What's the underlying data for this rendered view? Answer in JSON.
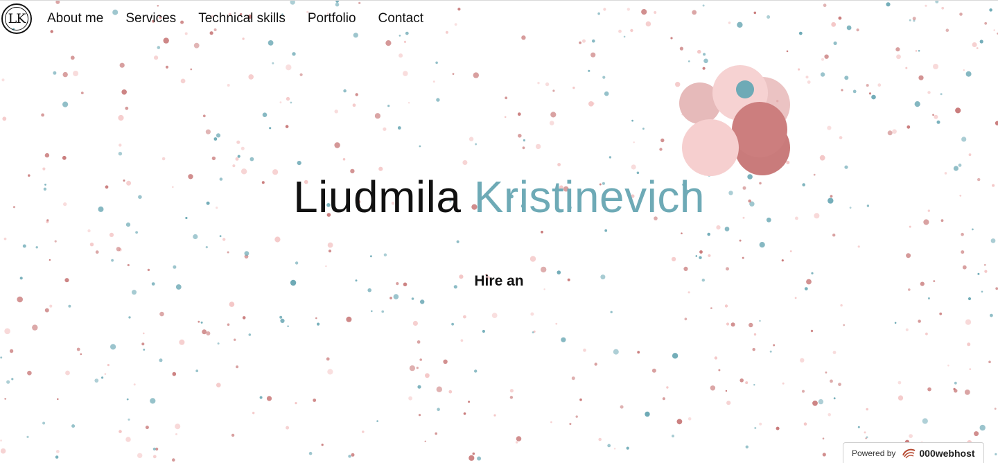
{
  "nav": {
    "logo_text": "LK",
    "links": [
      {
        "label": "About me"
      },
      {
        "label": "Services"
      },
      {
        "label": "Technical skills"
      },
      {
        "label": "Portfolio"
      },
      {
        "label": "Contact"
      }
    ]
  },
  "hero": {
    "first_name": "Liudmila",
    "last_name": "Kristinevich",
    "subtitle": "Hire an"
  },
  "badge": {
    "prefix": "Powered by",
    "brand": "000webhost",
    "icon": "000webhost-logo-icon"
  },
  "colors": {
    "accent": "#6eaab6",
    "dot_rose": "#c97b7b",
    "dot_pink": "#f4c6c6",
    "dot_teal": "#6eaab6"
  }
}
